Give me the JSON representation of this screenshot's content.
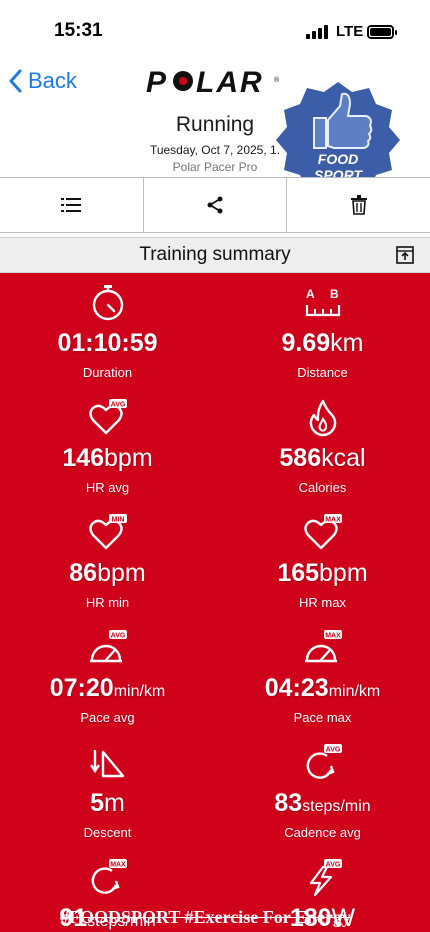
{
  "status_bar": {
    "time": "15:31",
    "network": "LTE"
  },
  "header": {
    "back_label": "Back",
    "logo_text": "POLAR",
    "title": "Running",
    "date": "Tuesday, Oct 7, 2025, 1.",
    "device": "Polar Pacer Pro"
  },
  "badge": {
    "line1": "FOOD",
    "line2": "SPORT"
  },
  "summary": {
    "title": "Training summary"
  },
  "metrics": [
    {
      "icon": "stopwatch-icon",
      "value": "01:10:59",
      "unit": "",
      "label": "Duration"
    },
    {
      "icon": "distance-ab-icon",
      "value": "9.69",
      "unit": "km",
      "label": "Distance"
    },
    {
      "icon": "heart-avg-icon",
      "value": "146",
      "unit": "bpm",
      "label": "HR avg"
    },
    {
      "icon": "flame-icon",
      "value": "586",
      "unit": "kcal",
      "label": "Calories"
    },
    {
      "icon": "heart-min-icon",
      "value": "86",
      "unit": "bpm",
      "label": "HR min"
    },
    {
      "icon": "heart-max-icon",
      "value": "165",
      "unit": "bpm",
      "label": "HR max"
    },
    {
      "icon": "gauge-avg-icon",
      "value": "07:20",
      "unit": "min/km",
      "label": "Pace avg"
    },
    {
      "icon": "gauge-max-icon",
      "value": "04:23",
      "unit": "min/km",
      "label": "Pace max"
    },
    {
      "icon": "descent-icon",
      "value": "5",
      "unit": "m",
      "label": "Descent"
    },
    {
      "icon": "cadence-avg-icon",
      "value": "83",
      "unit": "steps/min",
      "label": "Cadence avg"
    },
    {
      "icon": "cadence-max-icon",
      "value": "91",
      "unit": "steps/min",
      "label": ""
    },
    {
      "icon": "power-avg-icon",
      "value": "180",
      "unit": "W",
      "label": ""
    }
  ],
  "overlay": "#FOODSPORT #Exercise For Energy",
  "colors": {
    "accent_red": "#d0021b",
    "link_blue": "#1a7ce0",
    "badge_blue": "#3c5da8"
  }
}
